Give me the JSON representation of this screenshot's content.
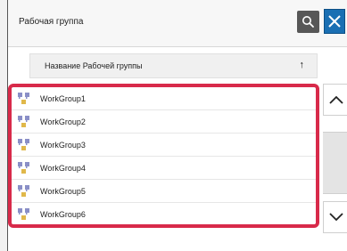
{
  "dialog": {
    "title": "Рабочая группа"
  },
  "toolbar": {
    "search_icon": "search-icon",
    "close_icon": "close-icon",
    "accent_color": "#1a6fb3"
  },
  "sort": {
    "label": "Название Рабочей группы",
    "direction_icon": "↑"
  },
  "list": {
    "highlight_color": "#d82a4a",
    "items": [
      {
        "label": "WorkGroup1"
      },
      {
        "label": "WorkGroup2"
      },
      {
        "label": "WorkGroup3"
      },
      {
        "label": "WorkGroup4"
      },
      {
        "label": "WorkGroup5"
      },
      {
        "label": "WorkGroup6"
      }
    ]
  },
  "scroll": {
    "up_icon": "chevron-up-icon",
    "down_icon": "chevron-down-icon"
  }
}
